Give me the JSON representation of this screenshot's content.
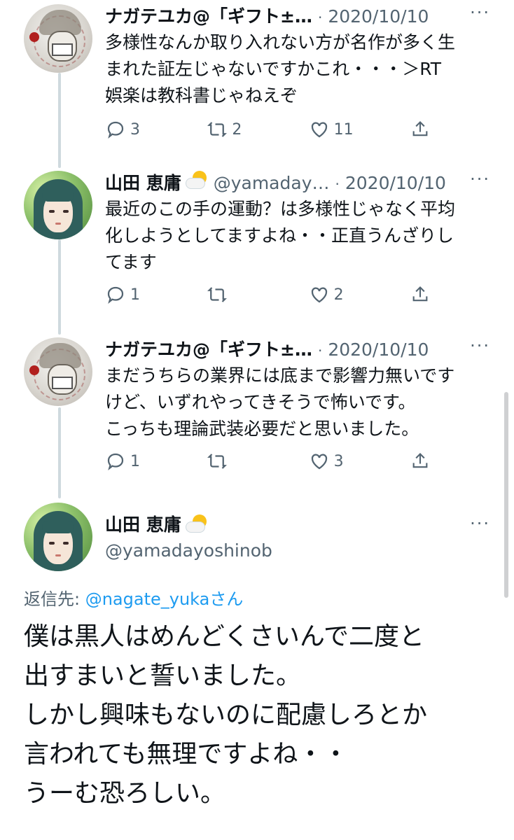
{
  "tweets": [
    {
      "author_name": "ナガテユカ@「ギフト±…",
      "handle": "",
      "date": "2020/10/10",
      "text_lines": [
        "多様性なんか取り入れない方が名作が多く生",
        "まれた証左じゃないですかこれ・・・＞RT",
        "娯楽は教科書じゃねえぞ"
      ],
      "reply_count": "3",
      "retweet_count": "2",
      "like_count": "11",
      "avatar_icon": "nagate-avatar"
    },
    {
      "author_name": "山田 恵庸",
      "handle": "@yamaday…",
      "date": "2020/10/10",
      "text_lines": [
        "最近のこの手の運動？は多様性じゃなく平均",
        "化しようとしてますよね・・正直うんざりし",
        "てます"
      ],
      "reply_count": "1",
      "retweet_count": "",
      "like_count": "2",
      "avatar_icon": "yamada-avatar"
    },
    {
      "author_name": "ナガテユカ@「ギフト±…",
      "handle": "",
      "date": "2020/10/10",
      "text_lines": [
        "まだうちらの業界には底まで影響力無いです",
        "けど、いずれやってきそうで怖いです。",
        "こっちも理論武装必要だと思いました。"
      ],
      "reply_count": "1",
      "retweet_count": "",
      "like_count": "3",
      "avatar_icon": "nagate-avatar"
    }
  ],
  "detail": {
    "author_name": "山田 恵庸",
    "handle": "@yamadayoshinob",
    "reply_prefix": "返信先: ",
    "reply_handle": "@nagate_yuka",
    "reply_suffix": "さん",
    "text_lines": [
      "僕は黒人はめんどくさいんで二度と",
      "出すまいと誓いました。",
      "しかし興味もないのに配慮しろとか",
      "言われても無理ですよね・・",
      "うーむ恐ろしい。"
    ]
  },
  "icons": {
    "more": "more-icon",
    "reply": "reply-icon",
    "retweet": "retweet-icon",
    "like": "like-icon",
    "share": "share-icon",
    "badge": "sun-behind-cloud-icon"
  },
  "colors": {
    "text": "#0f1419",
    "muted": "#536471",
    "link": "#1d9bf0",
    "thread_line": "#cfd9de"
  }
}
